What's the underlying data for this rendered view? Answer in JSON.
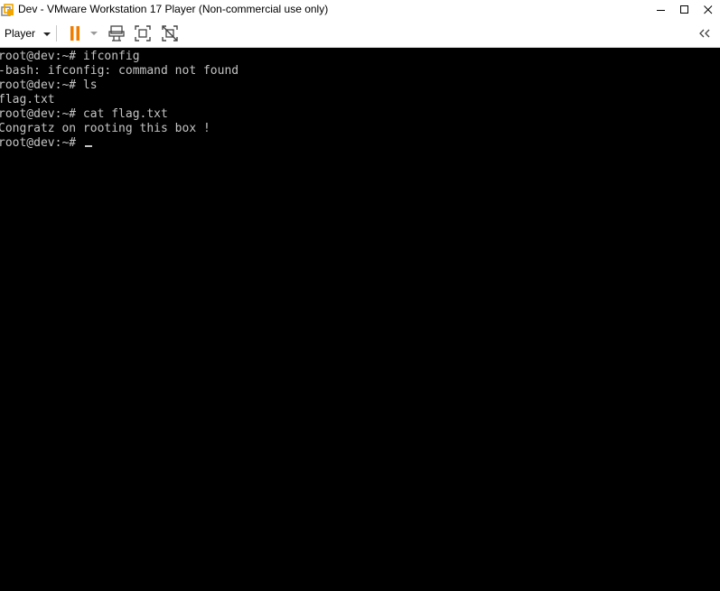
{
  "window": {
    "title": "Dev - VMware Workstation 17 Player (Non-commercial use only)",
    "icon": "vmware-player-icon",
    "controls": [
      "minimize-icon",
      "maximize-icon",
      "close-icon"
    ]
  },
  "toolbar": {
    "player_menu_label": "Player",
    "buttons": [
      "pause-icon",
      "dropdown-arrow-icon",
      "send-ctrl-alt-del-icon",
      "full-screen-icon",
      "unity-icon"
    ],
    "collapse_glyph": "<<",
    "accent_color": "#f07c00"
  },
  "console": {
    "lines": [
      "root@dev:~# ifconfig",
      "-bash: ifconfig: command not found",
      "root@dev:~# ls",
      "flag.txt",
      "root@dev:~# cat flag.txt",
      "Congratz on rooting this box !",
      "root@dev:~# "
    ],
    "text_color": "#c4c4c4",
    "background": "#000000"
  }
}
